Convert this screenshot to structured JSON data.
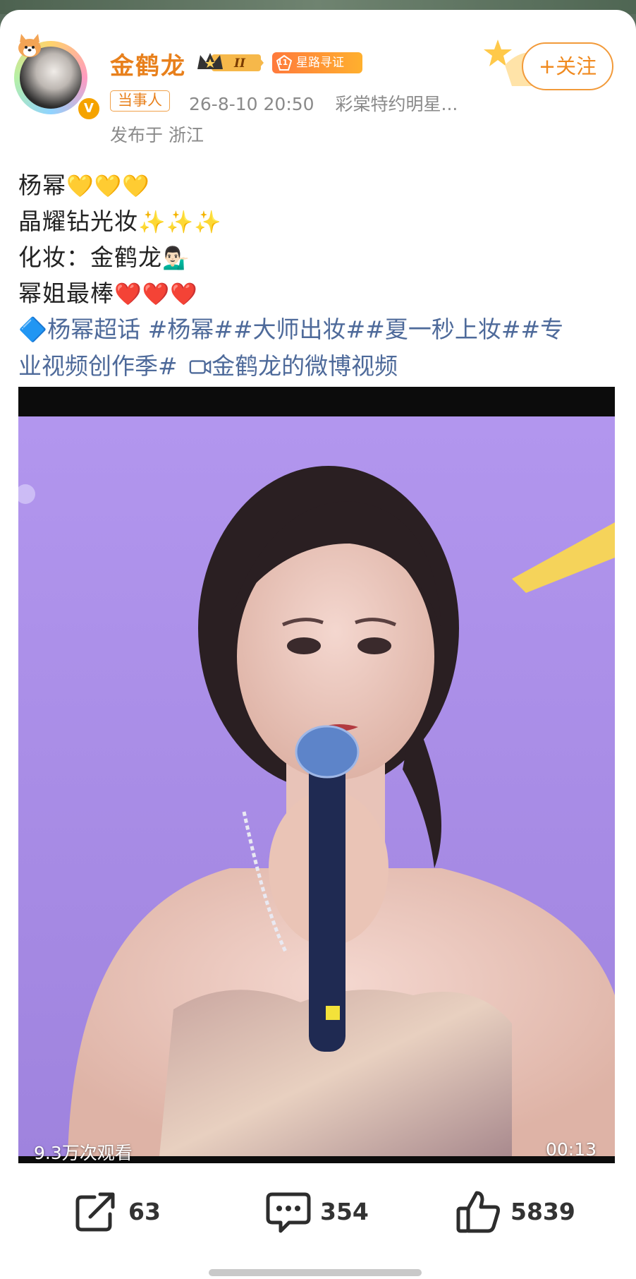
{
  "post": {
    "author": "金鹤龙",
    "level_badge": "II",
    "star_badge_num": "11",
    "star_badge": "星路寻证",
    "follow_label": "+关注",
    "party_tag": "当事人",
    "timestamp": "26-8-10 20:50",
    "source": "彩棠特约明星...",
    "location": "发布于 浙江",
    "lines": [
      {
        "text": "杨幂",
        "emoji": "💛💛💛"
      },
      {
        "text": "晶耀钻光妆",
        "emoji": "✨✨✨"
      },
      {
        "text": "化妆：金鹤龙",
        "emoji": "💁🏻‍♂️"
      },
      {
        "text": "幂姐最棒",
        "emoji": "❤️❤️❤️"
      }
    ],
    "topics": {
      "line1": "🔷杨幂超话 #杨幂##大师出妆##夏一秒上妆##专",
      "line2": "业视频创作季#",
      "video_link": "金鹤龙的微博视频"
    },
    "video": {
      "views": "9.3万次观看",
      "duration": "00:13"
    },
    "actions": {
      "reposts": "63",
      "comments": "354",
      "likes": "5839"
    }
  },
  "colors": {
    "accent_orange": "#e8801c",
    "link_blue": "#4e6a9a",
    "video_bg": "#a98ee8"
  },
  "icons": [
    "corgi-icon",
    "verified-v-icon",
    "crown-icon",
    "star-icon",
    "repost-icon",
    "comment-icon",
    "like-icon",
    "video-camera-icon"
  ]
}
